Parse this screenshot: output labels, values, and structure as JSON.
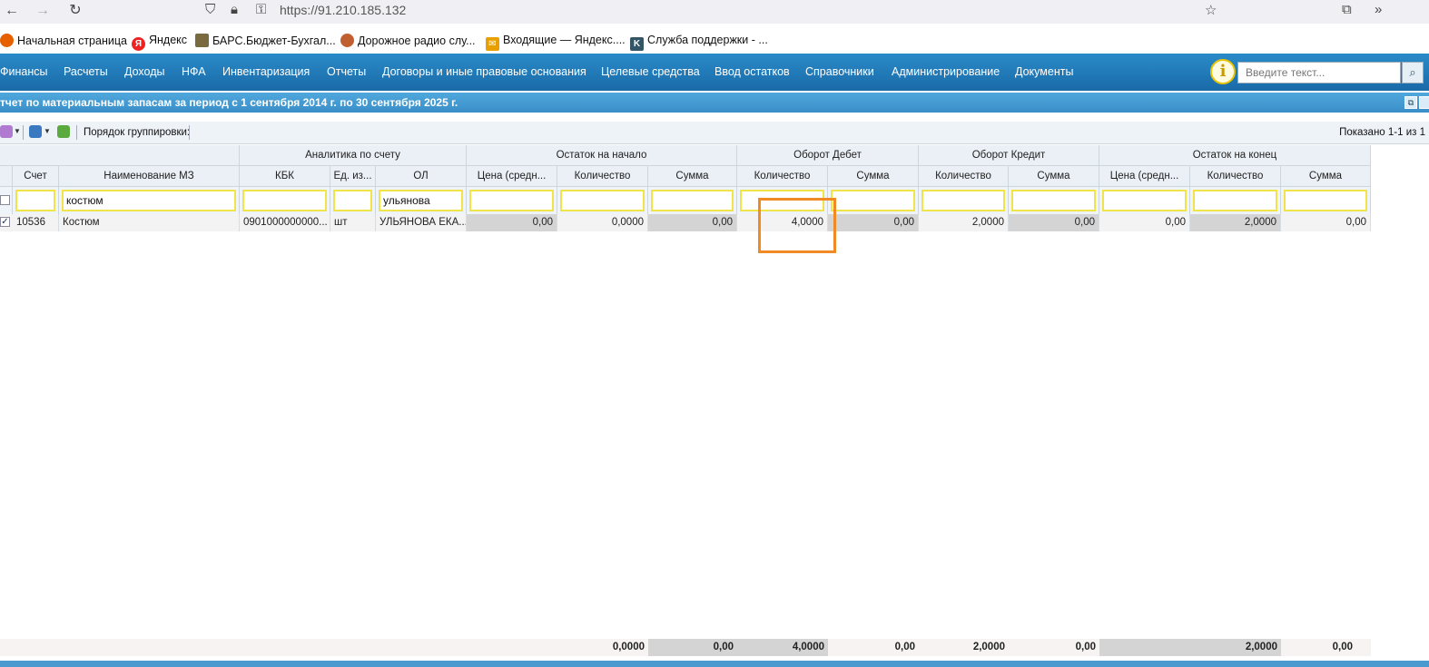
{
  "browser": {
    "url": "https://91.210.185.132",
    "bookmarks": [
      {
        "label": "Начальная страница"
      },
      {
        "label": "Яндекс"
      },
      {
        "label": "БАРС.Бюджет-Бухгал..."
      },
      {
        "label": "Дорожное радио слу..."
      },
      {
        "label": "Входящие — Яндекс...."
      },
      {
        "label": "Служба поддержки - ..."
      }
    ]
  },
  "menu": [
    "Финансы",
    "Расчеты",
    "Доходы",
    "НФА",
    "Инвентаризация",
    "Отчеты",
    "Договоры и иные правовые основания",
    "Целевые средства",
    "Ввод остатков",
    "Справочники",
    "Администрирование",
    "Документы"
  ],
  "search": {
    "placeholder": "Введите текст..."
  },
  "report": {
    "title": "тчет по материальным запасам за период с 1 сентября 2014 г. по 30 сентября 2025 г.",
    "grouping_label": "Порядок группировки:",
    "shown": "Показано 1-1 из 1"
  },
  "grid": {
    "groups": [
      "Аналитика по счету",
      "Остаток на начало",
      "Оборот Дебет",
      "Оборот Кредит",
      "Остаток на конец"
    ],
    "columns": [
      "Счет",
      "Наименование МЗ",
      "КБК",
      "Ед. из...",
      "ОЛ",
      "Цена (средн...",
      "Количество",
      "Сумма",
      "Количество",
      "Сумма",
      "Количество",
      "Сумма",
      "Цена (средн...",
      "Количество",
      "Сумма"
    ],
    "filters": [
      "",
      "костюм",
      "",
      "",
      "ульянова",
      "",
      "",
      "",
      "",
      "",
      "",
      "",
      "",
      "",
      ""
    ],
    "rows": [
      {
        "checked": "✓",
        "cells": [
          "10536",
          "Костюм",
          "0901000000000...",
          "шт",
          "УЛЬЯНОВА ЕКА...",
          "0,00",
          "0,0000",
          "0,00",
          "4,0000",
          "0,00",
          "2,0000",
          "0,00",
          "0,00",
          "2,0000",
          "0,00"
        ]
      }
    ],
    "totals": [
      "",
      "",
      "",
      "",
      "",
      "",
      "0,0000",
      "0,00",
      "4,0000",
      "0,00",
      "2,0000",
      "0,00",
      "",
      "2,0000",
      "0,00"
    ]
  },
  "colors": {
    "nav": "#1a6aa8",
    "highlight": "#f08a24",
    "filter_border": "#f0e44a"
  }
}
